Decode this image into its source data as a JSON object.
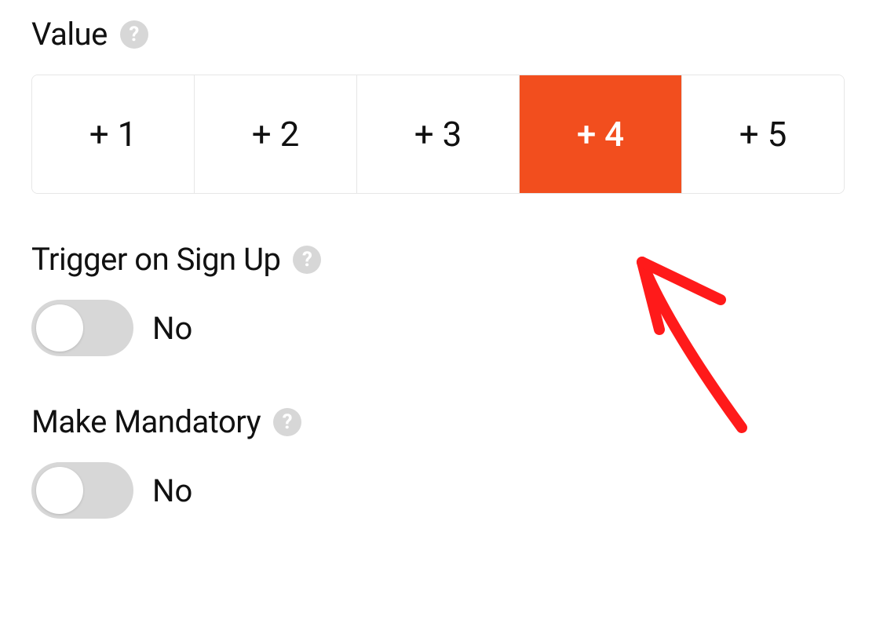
{
  "colors": {
    "accent": "#f24e1e",
    "help_icon_bg": "#d7d7d7",
    "toggle_off_bg": "#d7d7d7",
    "annotation": "#ff1a1a"
  },
  "value": {
    "label": "Value",
    "options": [
      "+ 1",
      "+ 2",
      "+ 3",
      "+ 4",
      "+ 5"
    ],
    "selected_index": 3
  },
  "trigger": {
    "label": "Trigger on Sign Up",
    "state": "No",
    "on": false
  },
  "mandatory": {
    "label": "Make Mandatory",
    "state": "No",
    "on": false
  }
}
